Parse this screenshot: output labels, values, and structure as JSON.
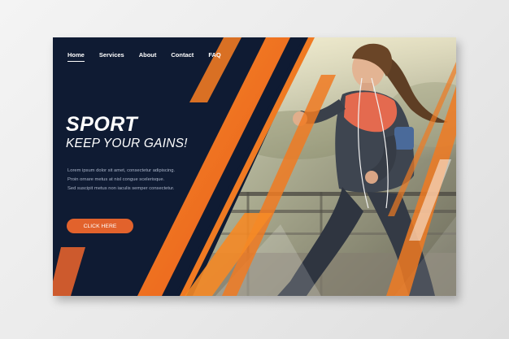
{
  "nav": {
    "items": [
      {
        "label": "Home",
        "active": true
      },
      {
        "label": "Services"
      },
      {
        "label": "About"
      },
      {
        "label": "Contact"
      },
      {
        "label": "FAQ"
      }
    ]
  },
  "hero": {
    "title": "SPORT",
    "subtitle": "KEEP YOUR GAINS!",
    "lines": [
      "Lorem ipsum dolor sit amet, consectetur adipiscing.",
      "Proin ornare metus at nisl congue scelerisque.",
      "Sed suscipit metus non iaculis semper consectetur."
    ],
    "cta_label": "CLICK HERE"
  },
  "colors": {
    "navy": "#0f1b33",
    "orange": "#f07a22",
    "button": "#e2622c"
  }
}
